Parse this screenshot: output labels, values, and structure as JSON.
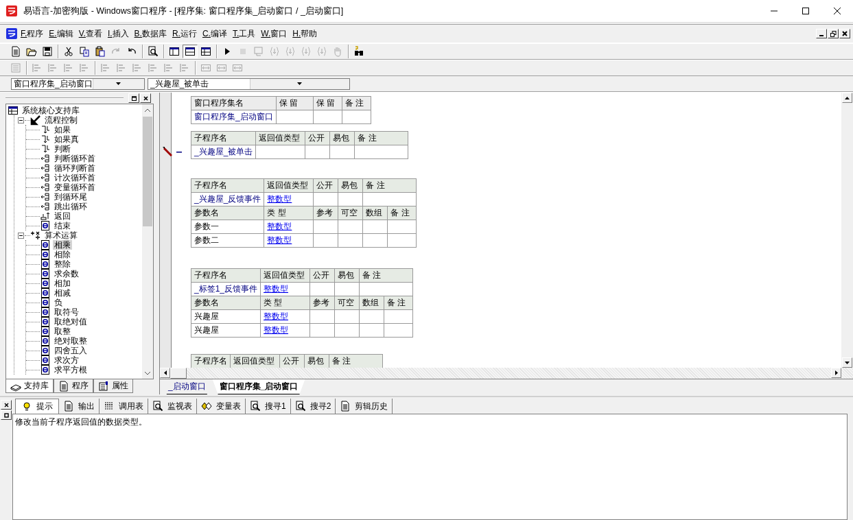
{
  "window": {
    "title": "易语言-加密狗版 - Windows窗口程序 - [程序集: 窗口程序集_启动窗口 / _启动窗口]"
  },
  "menu": [
    "F.程序",
    "E.编辑",
    "V.查看",
    "I.插入",
    "B.数据库",
    "R.运行",
    "C.编译",
    "T.工具",
    "W.窗口",
    "H.帮助"
  ],
  "toolbar_1": [
    [
      {
        "disabled": false
      },
      {
        "disabled": false
      },
      {
        "disabled": false
      }
    ],
    [
      {
        "disabled": false
      },
      {
        "disabled": false
      },
      {
        "disabled": false
      },
      {
        "disabled": true
      },
      {
        "disabled": false
      }
    ],
    [
      {
        "disabled": false
      }
    ],
    [
      {
        "disabled": false,
        "pressed": false
      },
      {
        "disabled": false,
        "pressed": true
      },
      {
        "disabled": false,
        "pressed": false
      }
    ],
    [
      {
        "disabled": false
      },
      {
        "disabled": true
      },
      {
        "disabled": true
      },
      {
        "disabled": true
      },
      {
        "disabled": true
      },
      {
        "disabled": true
      },
      {
        "disabled": true
      },
      {
        "disabled": true
      }
    ],
    [
      {
        "disabled": false
      }
    ]
  ],
  "toolbar_2": [
    [
      {
        "disabled": true
      }
    ],
    [
      {
        "disabled": true
      },
      {
        "disabled": true
      },
      {
        "disabled": true
      },
      {
        "disabled": true
      }
    ],
    [
      {
        "disabled": true
      },
      {
        "disabled": true
      },
      {
        "disabled": true
      },
      {
        "disabled": true
      },
      {
        "disabled": true
      },
      {
        "disabled": true
      }
    ],
    [
      {
        "disabled": true
      },
      {
        "disabled": true
      },
      {
        "disabled": true
      }
    ]
  ],
  "selectors": [
    {
      "value": "窗口程序集_启动窗口"
    },
    {
      "value": "_兴趣屋_被单击"
    }
  ],
  "library_panel": {
    "tree": {
      "label": "系统核心支持库",
      "kind": "library",
      "children": [
        {
          "label": "流程控制",
          "kind": "flow",
          "expanded": true,
          "children": [
            {
              "label": "如果",
              "kind": "branch",
              "selected": false
            },
            {
              "label": "如果真",
              "kind": "branch",
              "selected": false
            },
            {
              "label": "判断",
              "kind": "branch",
              "selected": false
            },
            {
              "label": "判断循环首",
              "kind": "loop",
              "selected": false
            },
            {
              "label": "循环判断首",
              "kind": "loop",
              "selected": false
            },
            {
              "label": "计次循环首",
              "kind": "loop",
              "selected": false
            },
            {
              "label": "变量循环首",
              "kind": "loop",
              "selected": false
            },
            {
              "label": "到循环尾",
              "kind": "loop",
              "selected": false
            },
            {
              "label": "跳出循环",
              "kind": "loop",
              "selected": false
            },
            {
              "label": "返回",
              "kind": "return",
              "selected": false
            },
            {
              "label": "结束",
              "kind": "command",
              "selected": false
            }
          ]
        },
        {
          "label": "算术运算",
          "kind": "math",
          "expanded": true,
          "children": [
            {
              "label": "相乘",
              "kind": "command",
              "selected": true
            },
            {
              "label": "相除",
              "kind": "command",
              "selected": false
            },
            {
              "label": "整除",
              "kind": "command",
              "selected": false
            },
            {
              "label": "求余数",
              "kind": "command",
              "selected": false
            },
            {
              "label": "相加",
              "kind": "command",
              "selected": false
            },
            {
              "label": "相减",
              "kind": "command",
              "selected": false
            },
            {
              "label": "负",
              "kind": "command",
              "selected": false
            },
            {
              "label": "取符号",
              "kind": "command",
              "selected": false
            },
            {
              "label": "取绝对值",
              "kind": "command",
              "selected": false
            },
            {
              "label": "取整",
              "kind": "command",
              "selected": false
            },
            {
              "label": "绝对取整",
              "kind": "command",
              "selected": false
            },
            {
              "label": "四舍五入",
              "kind": "command",
              "selected": false
            },
            {
              "label": "求次方",
              "kind": "command",
              "selected": false
            },
            {
              "label": "求平方根",
              "kind": "command",
              "selected": false
            }
          ]
        }
      ]
    },
    "tabs": [
      {
        "label": "支持库",
        "selected": true
      },
      {
        "label": "程序",
        "selected": false
      },
      {
        "label": "属性",
        "selected": false
      }
    ]
  },
  "editor": {
    "tables": [
      {
        "kind": "assembly",
        "editing": false,
        "rows": [
          {
            "kind": "header",
            "cells": [
              "窗口程序集名",
              "保 留",
              "保 留",
              "备 注"
            ]
          },
          {
            "kind": "name",
            "name": "窗口程序集_启动窗口"
          }
        ]
      },
      {
        "kind": "subroutine",
        "editing": true,
        "rows": [
          {
            "kind": "header",
            "cells": [
              "子程序名",
              "返回值类型",
              "公开",
              "易包",
              "备 注"
            ]
          },
          {
            "kind": "name",
            "name": "_兴趣屋_被单击"
          }
        ]
      },
      {
        "kind": "subroutine",
        "editing": false,
        "rows": [
          {
            "kind": "header",
            "cells": [
              "子程序名",
              "返回值类型",
              "公开",
              "易包",
              "备 注"
            ]
          },
          {
            "kind": "name",
            "name": "_兴趣屋_反馈事件",
            "type": "整数型"
          },
          {
            "kind": "header",
            "cells": [
              "参数名",
              "类 型",
              "参考",
              "可空",
              "数组",
              "备 注"
            ]
          },
          {
            "kind": "param",
            "name": "参数一",
            "type": "整数型"
          },
          {
            "kind": "param",
            "name": "参数二",
            "type": "整数型"
          }
        ]
      },
      {
        "kind": "subroutine",
        "editing": false,
        "rows": [
          {
            "kind": "header",
            "cells": [
              "子程序名",
              "返回值类型",
              "公开",
              "易包",
              "备 注"
            ]
          },
          {
            "kind": "name",
            "name": "_标签1_反馈事件",
            "type": "整数型"
          },
          {
            "kind": "header",
            "cells": [
              "参数名",
              "类 型",
              "参考",
              "可空",
              "数组",
              "备 注"
            ]
          },
          {
            "kind": "param",
            "name": "兴趣屋",
            "type": "整数型"
          },
          {
            "kind": "param",
            "name": "兴趣屋",
            "type": "整数型"
          }
        ]
      },
      {
        "kind": "subroutine",
        "editing": false,
        "rows": [
          {
            "kind": "header",
            "cells": [
              "子程序名",
              "返回值类型",
              "公开",
              "易包",
              "备 注"
            ]
          }
        ]
      }
    ],
    "tabs": [
      {
        "label": "_启动窗口",
        "selected": false
      },
      {
        "label": "窗口程序集_启动窗口",
        "selected": true
      }
    ]
  },
  "bottom_panel": {
    "tabs": [
      {
        "label": "提示",
        "selected": true
      },
      {
        "label": "输出",
        "selected": false
      },
      {
        "label": "调用表",
        "selected": false
      },
      {
        "label": "监视表",
        "selected": false
      },
      {
        "label": "变量表",
        "selected": false
      },
      {
        "label": "搜寻1",
        "selected": false
      },
      {
        "label": "搜寻2",
        "selected": false
      },
      {
        "label": "剪辑历史",
        "selected": false
      }
    ],
    "message": "修改当前子程序返回值的数据类型。"
  }
}
